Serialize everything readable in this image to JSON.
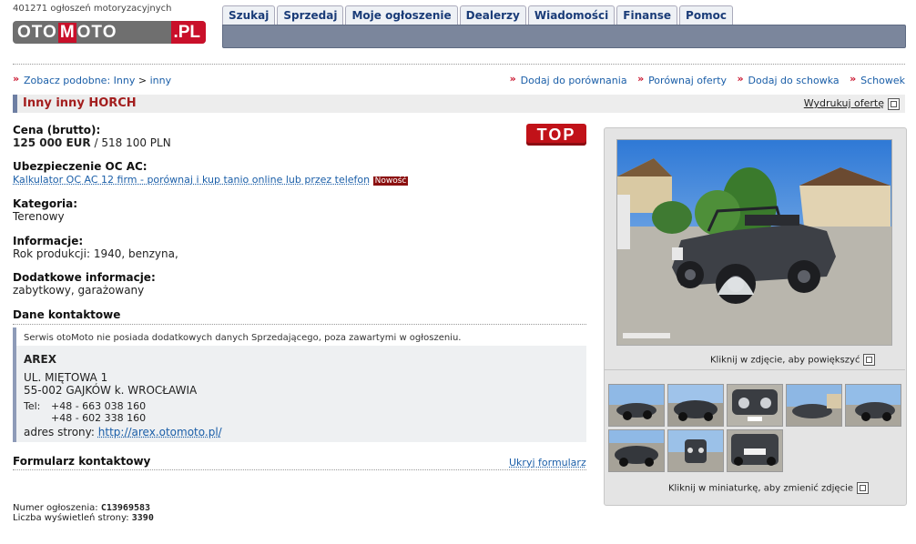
{
  "header": {
    "listing_count": "401271 ogłoszeń motoryzacyjnych",
    "logo": {
      "word1": "OTO",
      "m": "M",
      "word2": "OTO",
      "pl": ".PL"
    },
    "tabs": [
      "Szukaj",
      "Sprzedaj",
      "Moje ogłoszenie",
      "Dealerzy",
      "Wiadomości",
      "Finanse",
      "Pomoc"
    ]
  },
  "breadcrumb": {
    "prefix": "Zobacz podobne:",
    "items": [
      "Inny",
      "inny"
    ],
    "sep": ">"
  },
  "actions": [
    "Dodaj do porównania",
    "Porównaj oferty",
    "Dodaj do schowka",
    "Schowek"
  ],
  "title": "Inny inny HORCH",
  "print_label": "Wydrukuj ofertę",
  "top_badge": "TOP",
  "price": {
    "label": "Cena (brutto):",
    "main": "125 000 EUR",
    "sep": "/",
    "alt": "518 100 PLN"
  },
  "insurance": {
    "label": "Ubezpieczenie OC AC:",
    "link": "Kalkulator OC AC 12 firm - porównaj i kup tanio online lub przez telefon",
    "badge": "Nowość"
  },
  "category": {
    "label": "Kategoria:",
    "value": "Terenowy"
  },
  "info": {
    "label": "Informacje:",
    "value": "Rok produkcji: 1940, benzyna,"
  },
  "extra": {
    "label": "Dodatkowe informacje:",
    "value": "zabytkowy, garażowany"
  },
  "contact": {
    "heading": "Dane kontaktowe",
    "note": "Serwis otoMoto nie posiada dodatkowych danych Sprzedającego, poza zawartymi w ogłoszeniu.",
    "name": "AREX",
    "street": "UL. MIĘTOWA 1",
    "city": "55-002 GAJKÓW k. WROCŁAWIA",
    "tel_label": "Tel:",
    "phones": [
      "+48 - 663 038 160",
      "+48 - 602 338 160"
    ],
    "site_label": "adres strony:",
    "site_url": "http://arex.otomoto.pl/"
  },
  "form": {
    "heading": "Formularz kontaktowy",
    "hide": "Ukryj formularz"
  },
  "footer": {
    "id_label": "Numer ogłoszenia:",
    "id_value": "C13969583",
    "views_label": "Liczba wyświetleń strony:",
    "views_value": "3390"
  },
  "gallery": {
    "enlarge_hint": "Kliknij w zdjęcie, aby powiększyć",
    "thumb_hint": "Kliknij w miniaturkę, aby zmienić zdjęcie",
    "thumb_count": 8
  }
}
